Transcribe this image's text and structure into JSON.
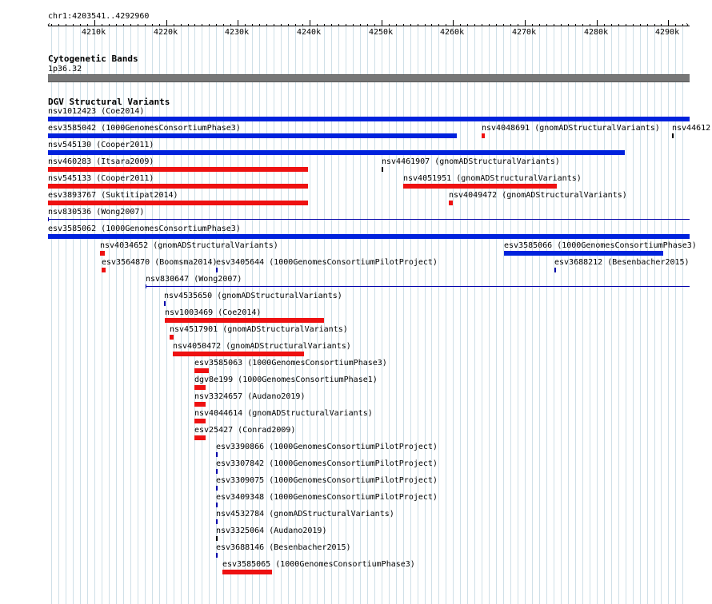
{
  "ruler": {
    "position": "chr1:4203541..4292960",
    "ticks": [
      "4210k",
      "4220k",
      "4230k",
      "4240k",
      "4250k",
      "4260k",
      "4270k",
      "4280k",
      "4290k"
    ]
  },
  "cytoband": {
    "title": "Cytogenetic Bands",
    "band": "1p36.32"
  },
  "dgv": {
    "title": "DGV Structural Variants",
    "colors": {
      "gain": "#0022dd",
      "loss": "#ee1111",
      "complex": "#000000",
      "inversion": "#0000aa"
    },
    "features": [
      {
        "label": "nsv1012423 (Coe2014)",
        "row": 0,
        "start": 4203541,
        "end": 4292960,
        "color": "gain"
      },
      {
        "label": "esv3585042 (1000GenomesConsortiumPhase3)",
        "row": 1,
        "start": 4203541,
        "end": 4260500,
        "color": "gain"
      },
      {
        "label": "nsv4048691 (gnomADStructuralVariants)",
        "row": 1,
        "start": 4263950,
        "end": 4264400,
        "color": "loss"
      },
      {
        "label": "nsv44612",
        "row": 1,
        "start": 4290460,
        "end": 4290620,
        "color": "complex"
      },
      {
        "label": "nsv545130 (Cooper2011)",
        "row": 2,
        "start": 4203541,
        "end": 4283900,
        "color": "gain"
      },
      {
        "label": "nsv460283 (Itsara2009)",
        "row": 3,
        "start": 4203541,
        "end": 4239750,
        "color": "loss"
      },
      {
        "label": "nsv4461907 (gnomADStructuralVariants)",
        "row": 3,
        "start": 4250000,
        "end": 4250220,
        "color": "complex"
      },
      {
        "label": "nsv545133 (Cooper2011)",
        "row": 4,
        "start": 4203541,
        "end": 4239750,
        "color": "loss"
      },
      {
        "label": "nsv4051951 (gnomADStructuralVariants)",
        "row": 4,
        "start": 4253100,
        "end": 4274500,
        "color": "loss"
      },
      {
        "label": "esv3893767 (Suktitipat2014)",
        "row": 5,
        "start": 4203541,
        "end": 4239750,
        "color": "loss"
      },
      {
        "label": "nsv4049472 (gnomADStructuralVariants)",
        "row": 5,
        "start": 4259350,
        "end": 4260000,
        "color": "loss"
      },
      {
        "label": "nsv830536 (Wong2007)",
        "row": 6,
        "start": 4203541,
        "end": 4292960,
        "color": "thin"
      },
      {
        "label": "esv3585062 (1000GenomesConsortiumPhase3)",
        "row": 7,
        "start": 4203541,
        "end": 4292960,
        "color": "gain"
      },
      {
        "label": "nsv4034652 (gnomADStructuralVariants)",
        "row": 8,
        "start": 4210800,
        "end": 4211500,
        "color": "loss"
      },
      {
        "label": "esv3585066 (1000GenomesConsortiumPhase3)",
        "row": 8,
        "start": 4267100,
        "end": 4289250,
        "color": "gain"
      },
      {
        "label": "esv3564870 (Boomsma2014)",
        "row": 9,
        "start": 4211050,
        "end": 4211600,
        "color": "loss"
      },
      {
        "label": "esv3405644 (1000GenomesConsortiumPilotProject)",
        "row": 9,
        "start": 4227000,
        "end": 4227200,
        "color": "inversion"
      },
      {
        "label": "esv3688212 (Besenbacher2015)",
        "row": 9,
        "start": 4274100,
        "end": 4274300,
        "color": "inversion"
      },
      {
        "label": "nsv830647 (Wong2007)",
        "row": 10,
        "start": 4217150,
        "end": 4292960,
        "color": "thin"
      },
      {
        "label": "nsv4535650 (gnomADStructuralVariants)",
        "row": 11,
        "start": 4219700,
        "end": 4219900,
        "color": "inversion"
      },
      {
        "label": "nsv1003469 (Coe2014)",
        "row": 12,
        "start": 4219800,
        "end": 4242000,
        "color": "loss"
      },
      {
        "label": "nsv4517901 (gnomADStructuralVariants)",
        "row": 13,
        "start": 4220500,
        "end": 4221000,
        "color": "loss"
      },
      {
        "label": "nsv4050472 (gnomADStructuralVariants)",
        "row": 14,
        "start": 4220900,
        "end": 4239200,
        "color": "loss"
      },
      {
        "label": "esv3585063 (1000GenomesConsortiumPhase3)",
        "row": 15,
        "start": 4223900,
        "end": 4226000,
        "color": "loss"
      },
      {
        "label": "dgv8e199 (1000GenomesConsortiumPhase1)",
        "row": 16,
        "start": 4223900,
        "end": 4225500,
        "color": "loss"
      },
      {
        "label": "nsv3324657 (Audano2019)",
        "row": 17,
        "start": 4224000,
        "end": 4225500,
        "color": "loss"
      },
      {
        "label": "nsv4044614 (gnomADStructuralVariants)",
        "row": 18,
        "start": 4224000,
        "end": 4225500,
        "color": "loss"
      },
      {
        "label": "esv25427 (Conrad2009)",
        "row": 19,
        "start": 4224000,
        "end": 4225500,
        "color": "loss"
      },
      {
        "label": "esv3390866 (1000GenomesConsortiumPilotProject)",
        "row": 20,
        "start": 4227000,
        "end": 4227200,
        "color": "inversion"
      },
      {
        "label": "esv3307842 (1000GenomesConsortiumPilotProject)",
        "row": 21,
        "start": 4227000,
        "end": 4227200,
        "color": "inversion"
      },
      {
        "label": "esv3309075 (1000GenomesConsortiumPilotProject)",
        "row": 22,
        "start": 4227000,
        "end": 4227200,
        "color": "inversion"
      },
      {
        "label": "esv3409348 (1000GenomesConsortiumPilotProject)",
        "row": 23,
        "start": 4227000,
        "end": 4227200,
        "color": "inversion"
      },
      {
        "label": "nsv4532784 (gnomADStructuralVariants)",
        "row": 24,
        "start": 4227000,
        "end": 4227200,
        "color": "inversion"
      },
      {
        "label": "nsv3325064 (Audano2019)",
        "row": 25,
        "start": 4227000,
        "end": 4227200,
        "color": "complex"
      },
      {
        "label": "esv3688146 (Besenbacher2015)",
        "row": 26,
        "start": 4227000,
        "end": 4227200,
        "color": "inversion"
      },
      {
        "label": "esv3585065 (1000GenomesConsortiumPhase3)",
        "row": 27,
        "start": 4227900,
        "end": 4234800,
        "color": "loss"
      }
    ]
  }
}
